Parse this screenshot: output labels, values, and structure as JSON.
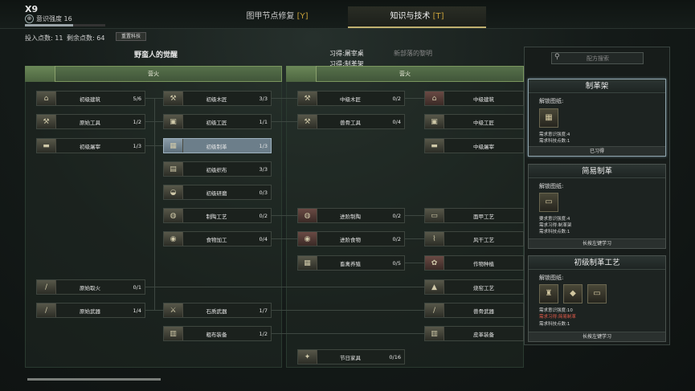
{
  "header": {
    "level": "X9",
    "knowledge_icon": "⊕",
    "knowledge_label": "意识强度 16",
    "knowledge_progress": 0.6,
    "tabs": [
      {
        "label": "图甲节点修复",
        "key": "[Y]"
      },
      {
        "label": "知识与技术",
        "key": "[T]"
      }
    ],
    "invested_points": "投入点数: 11",
    "remaining_points": "剩余点数: 64",
    "reset_label": "重置科技"
  },
  "tree": {
    "left_title": "野蛮人的觉醒",
    "learned_1": "习得:屠宰桌",
    "learned_2": "习得:制革架",
    "right_title": "新部落的黎明",
    "left_band": "营火",
    "right_band": "营火",
    "left_nodes": {
      "n1": {
        "name": "初级建筑",
        "count": "5/6",
        "icon": "⌂"
      },
      "n2": {
        "name": "原始工具",
        "count": "1/2",
        "icon": "⚒"
      },
      "n3": {
        "name": "初级屠宰",
        "count": "1/3",
        "icon": "▬"
      },
      "n4": {
        "name": "初级木匠",
        "count": "3/3",
        "icon": "⚒"
      },
      "n5": {
        "name": "初级工匠",
        "count": "1/1",
        "icon": "▣"
      },
      "n6": {
        "name": "初级制革",
        "count": "1/3",
        "icon": "▦"
      },
      "n7": {
        "name": "初级织布",
        "count": "3/3",
        "icon": "▤"
      },
      "n8": {
        "name": "初级研磨",
        "count": "0/3",
        "icon": "◒"
      },
      "n9": {
        "name": "制陶工艺",
        "count": "0/2",
        "icon": "◍"
      },
      "n10": {
        "name": "食物加工",
        "count": "0/4",
        "icon": "◉"
      },
      "n11": {
        "name": "原始取火",
        "count": "0/1",
        "icon": "/"
      },
      "n12": {
        "name": "原始武器",
        "count": "1/4",
        "icon": "/"
      },
      "n13": {
        "name": "石质武器",
        "count": "1/7",
        "icon": "⚔"
      },
      "n14": {
        "name": "粗布装备",
        "count": "1/2",
        "icon": "▥"
      }
    },
    "right_nodes": {
      "m1": {
        "name": "中级木匠",
        "count": "0/2",
        "icon": "⚒"
      },
      "m2": {
        "name": "兽骨工具",
        "count": "0/4",
        "icon": "⚒"
      },
      "m3": {
        "name": "中级建筑",
        "count": "",
        "icon": "⌂"
      },
      "m4": {
        "name": "中级工匠",
        "count": "",
        "icon": "▣"
      },
      "m5": {
        "name": "中级屠宰",
        "count": "",
        "icon": "▬"
      },
      "m6": {
        "name": "进阶制陶",
        "count": "0/2",
        "icon": "◍"
      },
      "m7": {
        "name": "进阶食物",
        "count": "0/2",
        "icon": "◉"
      },
      "m8": {
        "name": "畜禽养殖",
        "count": "0/5",
        "icon": "▦"
      },
      "m9": {
        "name": "面甲工艺",
        "count": "",
        "icon": "▭"
      },
      "m10": {
        "name": "风干工艺",
        "count": "",
        "icon": "⌇"
      },
      "m11": {
        "name": "作物种植",
        "count": "",
        "icon": "✿"
      },
      "m12": {
        "name": "烧窑工艺",
        "count": "",
        "icon": "▲"
      },
      "m13": {
        "name": "兽骨武器",
        "count": "",
        "icon": "/"
      },
      "m14": {
        "name": "皮革装备",
        "count": "",
        "icon": "▥"
      },
      "m15": {
        "name": "节日家具",
        "count": "0/16",
        "icon": "✦"
      }
    }
  },
  "sidebar": {
    "search_placeholder": "配方搜索",
    "search_icon": "⚲",
    "cards": [
      {
        "title": "制革架",
        "unlock_label": "解锁图纸:",
        "icons": [
          "▦"
        ],
        "lines": [
          {
            "text": "需求意识强度:4",
            "warn": false
          },
          {
            "text": "需求科技点数:1",
            "warn": false
          }
        ],
        "footer": "已习得"
      },
      {
        "title": "简易制革",
        "unlock_label": "解锁图纸:",
        "icons": [
          "▭"
        ],
        "lines": [
          {
            "text": "要求意识强度:4",
            "warn": false
          },
          {
            "text": "需求习得:制革架",
            "warn": false
          },
          {
            "text": "需求科技点数:1",
            "warn": false
          }
        ],
        "footer": "长按左键学习"
      },
      {
        "title": "初级制革工艺",
        "unlock_label": "解锁图纸:",
        "icons": [
          "♜",
          "◆",
          "▭"
        ],
        "lines": [
          {
            "text": "需求意识强度:10",
            "warn": false
          },
          {
            "text": "需求习得:简易制革",
            "warn": true
          },
          {
            "text": "需求科技点数:1",
            "warn": false
          }
        ],
        "footer": "长按左键学习"
      }
    ]
  }
}
